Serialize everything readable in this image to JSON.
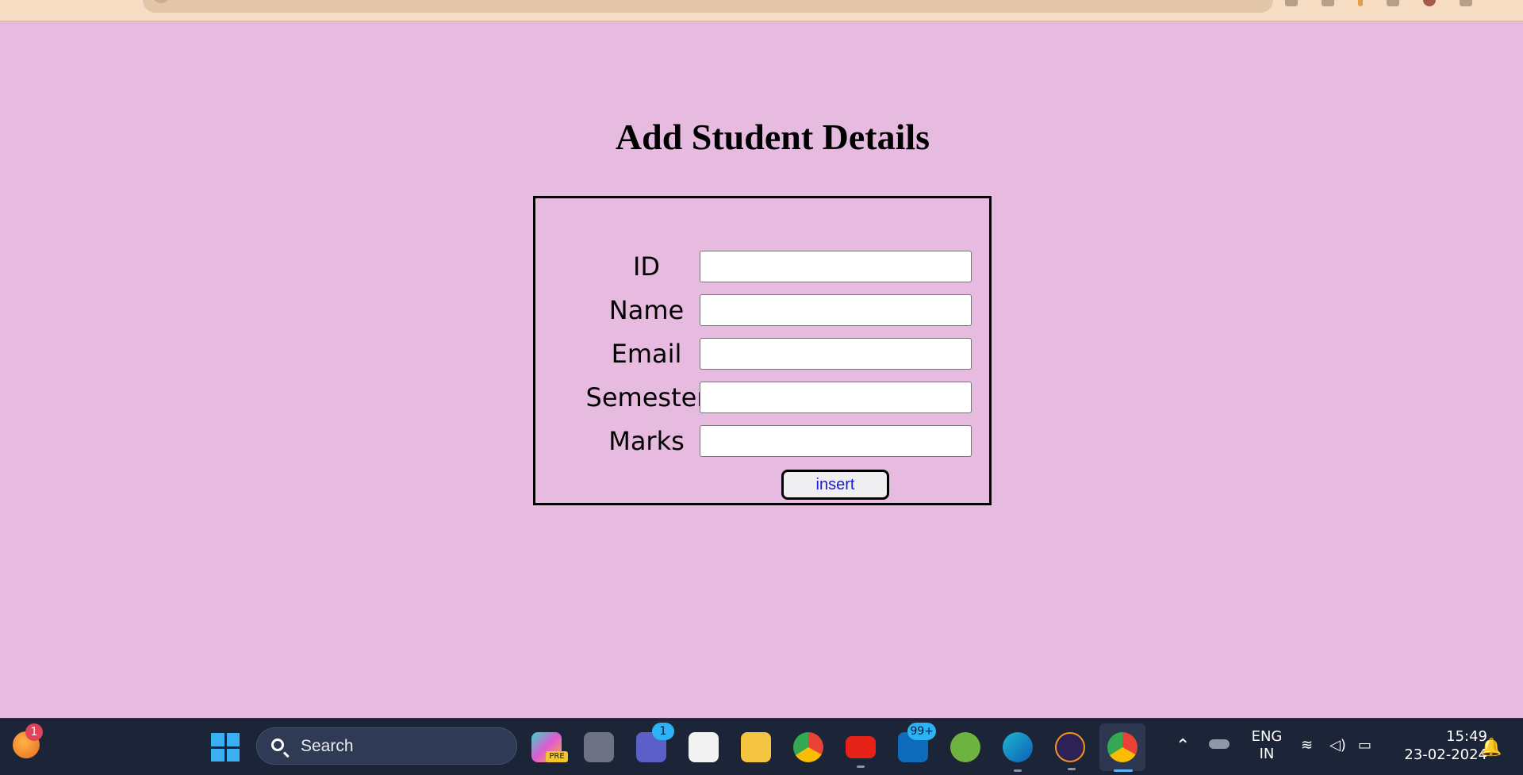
{
  "page": {
    "heading": "Add Student Details",
    "background_color": "#e6bbdf"
  },
  "form": {
    "fields": [
      {
        "label": "ID",
        "value": ""
      },
      {
        "label": "Name",
        "value": ""
      },
      {
        "label": "Email",
        "value": ""
      },
      {
        "label": "Semester",
        "value": ""
      },
      {
        "label": "Marks",
        "value": ""
      }
    ],
    "submit_label": "insert"
  },
  "taskbar": {
    "widgets_badge": "1",
    "search_placeholder": "Search",
    "apps": [
      {
        "name": "copilot-icon",
        "badge": "PRE"
      },
      {
        "name": "task-view-icon"
      },
      {
        "name": "teams-icon",
        "badge": "1"
      },
      {
        "name": "microsoft-store-icon"
      },
      {
        "name": "file-explorer-icon"
      },
      {
        "name": "chrome-icon"
      },
      {
        "name": "youtube-icon"
      },
      {
        "name": "outlook-icon",
        "badge": "99+"
      },
      {
        "name": "spring-tool-suite-icon"
      },
      {
        "name": "edge-icon"
      },
      {
        "name": "eclipse-icon"
      },
      {
        "name": "chrome-profile-icon"
      }
    ],
    "language_line1": "ENG",
    "language_line2": "IN",
    "time": "15:49",
    "date": "23-02-2024",
    "accent_color": "#5bb4ff"
  }
}
